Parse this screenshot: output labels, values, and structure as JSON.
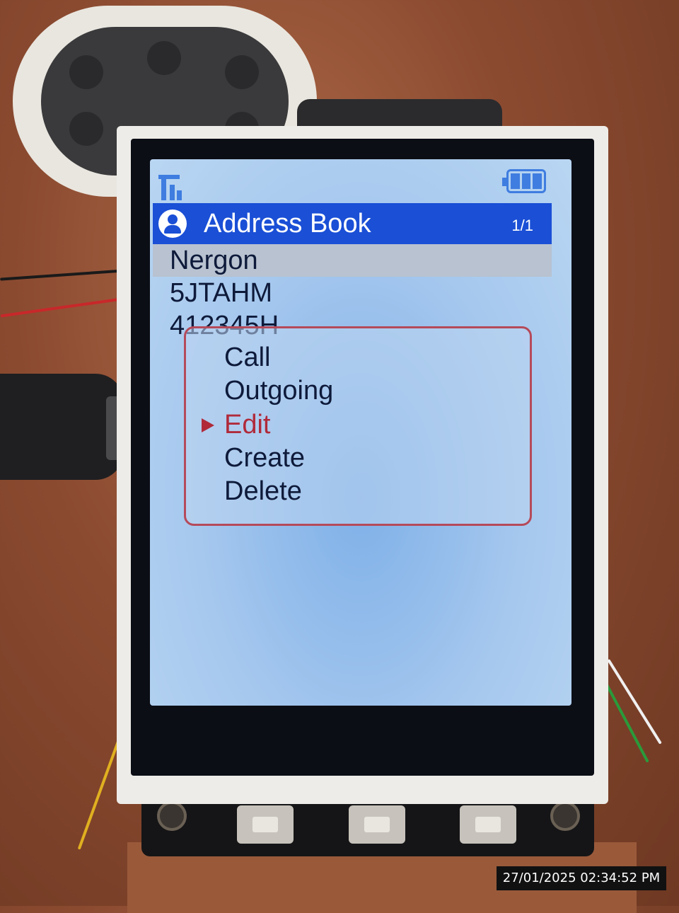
{
  "status_bar": {
    "signal_icon": "signal-antenna-icon",
    "battery_icon": "battery-full-icon",
    "accent_color": "#3f7de0"
  },
  "title_bar": {
    "icon": "contact-person-icon",
    "title": "Address Book",
    "page_counter": "1/1",
    "background_color": "#1a4fd6"
  },
  "contacts": [
    {
      "name": "Nergon",
      "selected": true
    },
    {
      "name": "5JTAHM",
      "selected": false
    },
    {
      "name": "412345H",
      "selected": false
    }
  ],
  "context_menu": {
    "items": [
      {
        "label": "Call",
        "active": false
      },
      {
        "label": "Outgoing",
        "active": false
      },
      {
        "label": "Edit",
        "active": true
      },
      {
        "label": "Create",
        "active": false
      },
      {
        "label": "Delete",
        "active": false
      }
    ],
    "pointer_icon": "triangle-right-icon",
    "active_color": "#b02a3a",
    "border_color": "#b54a5a"
  },
  "photo_timestamp": "27/01/2025 02:34:52 PM"
}
